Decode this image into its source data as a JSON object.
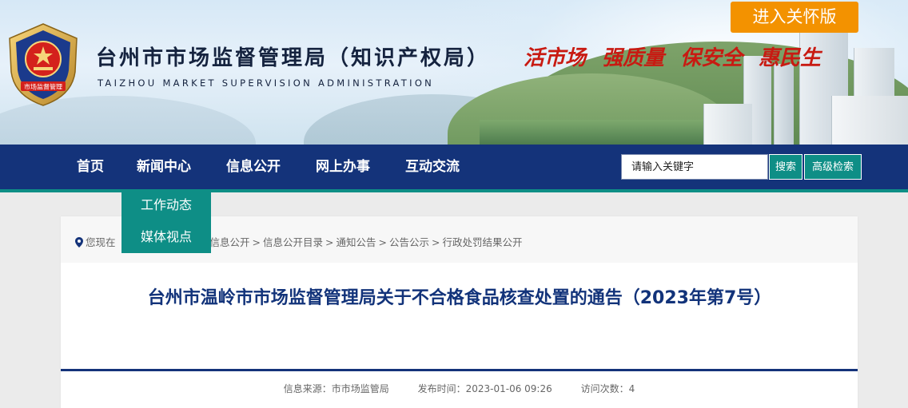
{
  "header": {
    "title_cn": "台州市市场监督管理局（知识产权局）",
    "title_en": "TAIZHOU MARKET SUPERVISION ADMINISTRATION",
    "emblem_text": "市场监督管理",
    "slogans": [
      "活市场",
      "强质量",
      "保安全",
      "惠民生"
    ],
    "care_button": "进入关怀版"
  },
  "nav": {
    "items": [
      "首页",
      "新闻中心",
      "信息公开",
      "网上办事",
      "互动交流"
    ],
    "search_placeholder": "请输入关键字",
    "search_button": "搜索",
    "advanced_button": "高级检索"
  },
  "dropdown": {
    "items": [
      "工作动态",
      "媒体视点"
    ]
  },
  "breadcrumb": {
    "prefix": "您现在",
    "items": [
      "信息公开",
      "信息公开目录",
      "通知公告",
      "公告公示",
      "行政处罚结果公开"
    ]
  },
  "article": {
    "title": "台州市温岭市市场监督管理局关于不合格食品核查处置的通告（2023年第7号）",
    "source": "信息来源：市市场监管局",
    "date": "发布时间：2023-01-06 09:26",
    "views": "访问次数：4"
  },
  "colors": {
    "nav_bg": "#14337a",
    "accent_teal": "#0e8e86",
    "care_orange": "#f39200",
    "slogan_red": "#c81a12",
    "title_blue": "#12337a"
  }
}
